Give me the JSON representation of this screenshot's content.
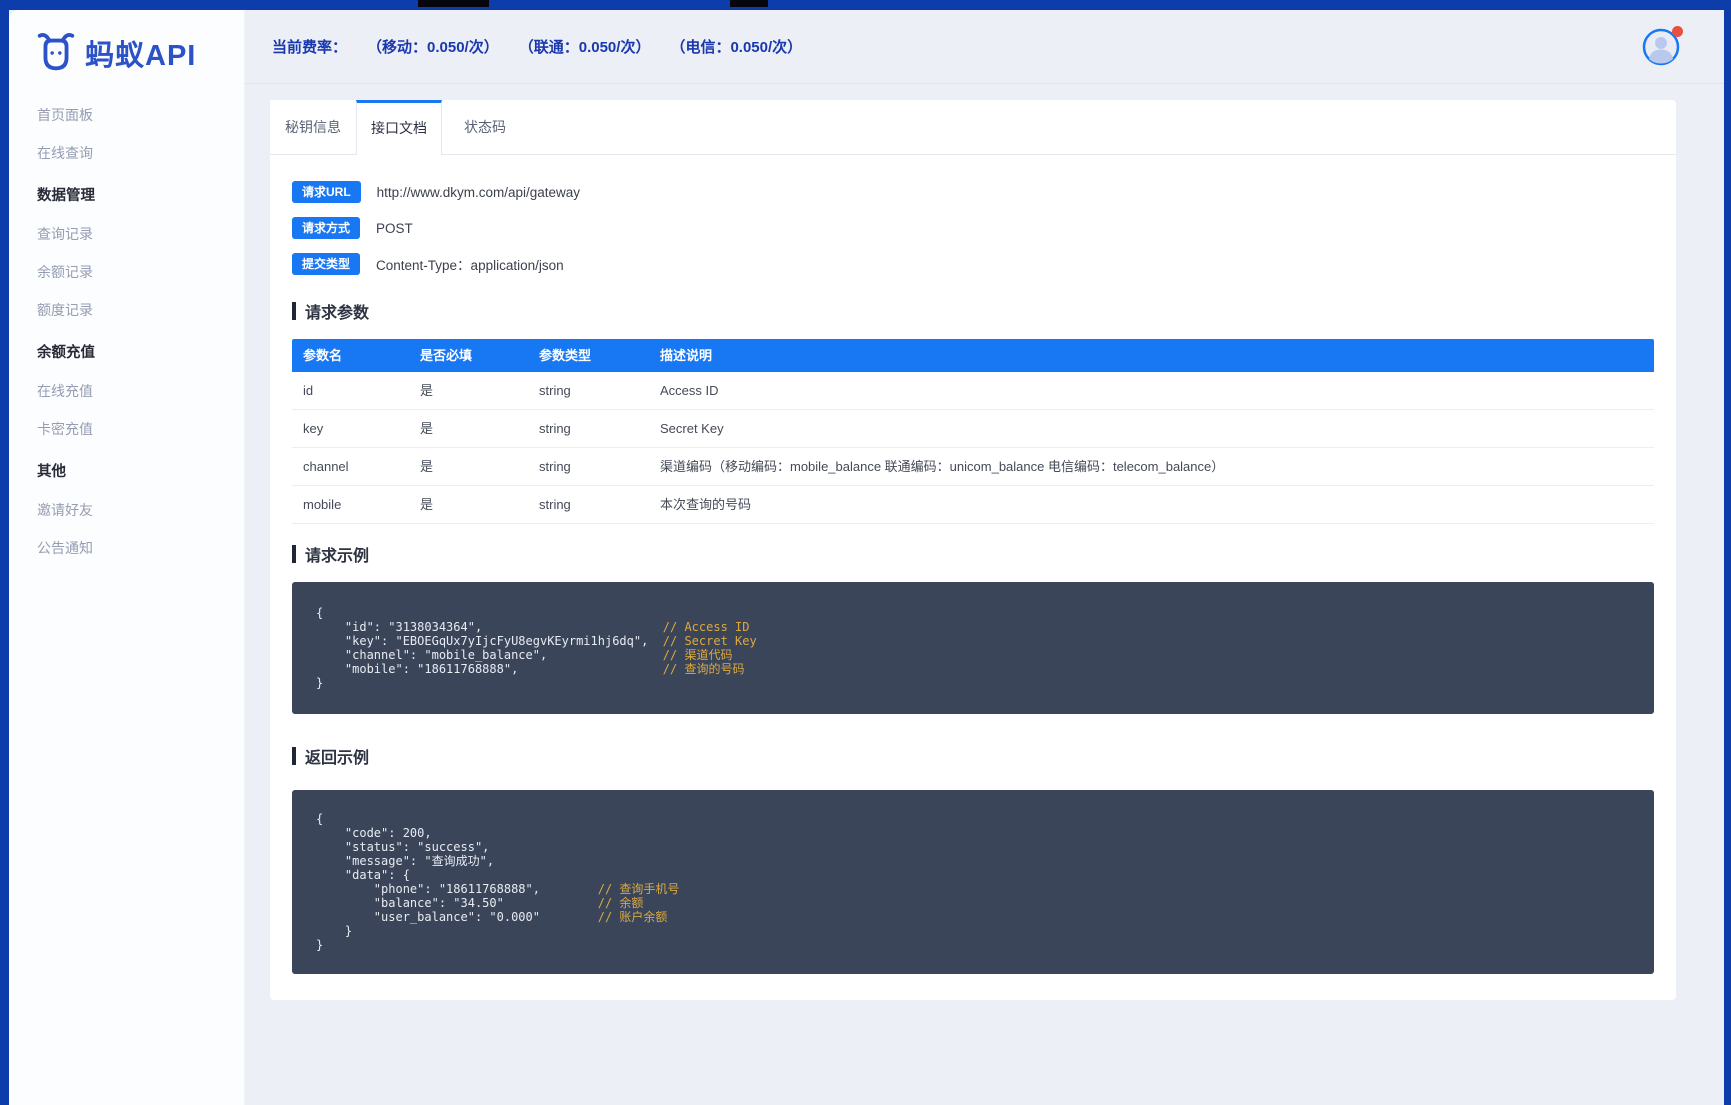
{
  "logo": {
    "title": "蚂蚁API"
  },
  "topbar": {
    "rate_label": "当前费率：",
    "rates": [
      "（移动：0.050/次）",
      "（联通：0.050/次）",
      "（电信：0.050/次）"
    ]
  },
  "sidebar": {
    "items": [
      {
        "label": "首页面板",
        "type": "link"
      },
      {
        "label": "在线查询",
        "type": "link"
      },
      {
        "label": "数据管理",
        "type": "section"
      },
      {
        "label": "查询记录",
        "type": "link"
      },
      {
        "label": "余额记录",
        "type": "link"
      },
      {
        "label": "额度记录",
        "type": "link"
      },
      {
        "label": "余额充值",
        "type": "section"
      },
      {
        "label": "在线充值",
        "type": "link"
      },
      {
        "label": "卡密充值",
        "type": "link"
      },
      {
        "label": "其他",
        "type": "section"
      },
      {
        "label": "邀请好友",
        "type": "link"
      },
      {
        "label": "公告通知",
        "type": "link"
      }
    ]
  },
  "tabs": {
    "items": [
      {
        "label": "秘钥信息",
        "active": false
      },
      {
        "label": "接口文档",
        "active": true
      },
      {
        "label": "状态码",
        "active": false
      }
    ]
  },
  "request_info": {
    "rows": [
      {
        "badge": "请求URL",
        "value": "http://www.dkym.com/api/gateway"
      },
      {
        "badge": "请求方式",
        "value": "POST"
      },
      {
        "badge": "提交类型",
        "value": "Content-Type：application/json"
      }
    ]
  },
  "sections": {
    "params": "请求参数",
    "request_example": "请求示例",
    "response_example": "返回示例"
  },
  "params_table": {
    "headers": [
      "参数名",
      "是否必填",
      "参数类型",
      "描述说明"
    ],
    "rows": [
      [
        "id",
        "是",
        "string",
        "Access ID"
      ],
      [
        "key",
        "是",
        "string",
        "Secret Key"
      ],
      [
        "channel",
        "是",
        "string",
        "渠道编码（移动编码：mobile_balance 联通编码：unicom_balance 电信编码：telecom_balance）"
      ],
      [
        "mobile",
        "是",
        "string",
        "本次查询的号码"
      ]
    ]
  },
  "request_example": {
    "lines": [
      {
        "code": "{",
        "comment": ""
      },
      {
        "code": "    \"id\": \"3138034364\",",
        "comment": "// Access ID"
      },
      {
        "code": "    \"key\": \"EBOEGqUx7yIjcFyU8egvKEyrmi1hj6dq\",",
        "comment": "// Secret Key"
      },
      {
        "code": "    \"channel\": \"mobile_balance\",",
        "comment": "// 渠道代码"
      },
      {
        "code": "    \"mobile\": \"18611768888\",",
        "comment": "// 查询的号码"
      },
      {
        "code": "}",
        "comment": ""
      }
    ]
  },
  "response_example": {
    "lines": [
      {
        "code": "{",
        "comment": ""
      },
      {
        "code": "    \"code\": 200,",
        "comment": ""
      },
      {
        "code": "    \"status\": \"success\",",
        "comment": ""
      },
      {
        "code": "    \"message\": \"查询成功\",",
        "comment": ""
      },
      {
        "code": "    \"data\": {",
        "comment": ""
      },
      {
        "code": "        \"phone\": \"18611768888\",",
        "comment": "// 查询手机号"
      },
      {
        "code": "        \"balance\": \"34.50\"",
        "comment": "// 余额"
      },
      {
        "code": "        \"user_balance\": \"0.000\"",
        "comment": "// 账户余额"
      },
      {
        "code": "    }",
        "comment": ""
      },
      {
        "code": "}",
        "comment": ""
      }
    ]
  },
  "colors": {
    "primary": "#1877f2",
    "frame": "#0d3dab",
    "logo_blue": "#2b52c8",
    "code_bg": "#3a455a",
    "code_comment": "#dba940",
    "notification": "#e8503f"
  }
}
